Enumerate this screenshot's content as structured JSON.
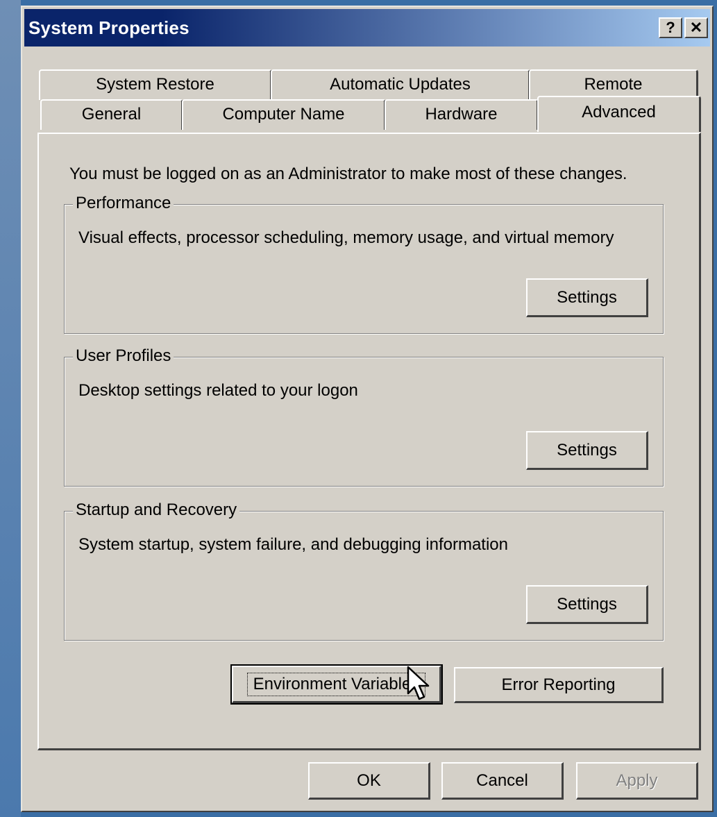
{
  "window": {
    "title": "System Properties",
    "help_label": "?",
    "close_label": "✕"
  },
  "tabs": {
    "row1": [
      {
        "label": "System Restore"
      },
      {
        "label": "Automatic Updates"
      },
      {
        "label": "Remote"
      }
    ],
    "row2": [
      {
        "label": "General"
      },
      {
        "label": "Computer Name"
      },
      {
        "label": "Hardware"
      },
      {
        "label": "Advanced",
        "active": true
      }
    ]
  },
  "advanced": {
    "admin_note": "You must be logged on as an Administrator to make most of these changes.",
    "performance": {
      "title": "Performance",
      "description": "Visual effects, processor scheduling, memory usage, and virtual memory",
      "button": "Settings"
    },
    "user_profiles": {
      "title": "User Profiles",
      "description": "Desktop settings related to your logon",
      "button": "Settings"
    },
    "startup_recovery": {
      "title": "Startup and Recovery",
      "description": "System startup, system failure, and debugging information",
      "button": "Settings"
    },
    "env_vars_button": "Environment Variables",
    "error_reporting_button": "Error Reporting"
  },
  "footer": {
    "ok": "OK",
    "cancel": "Cancel",
    "apply": "Apply"
  },
  "cursor_icon": "arrow-cursor-icon"
}
